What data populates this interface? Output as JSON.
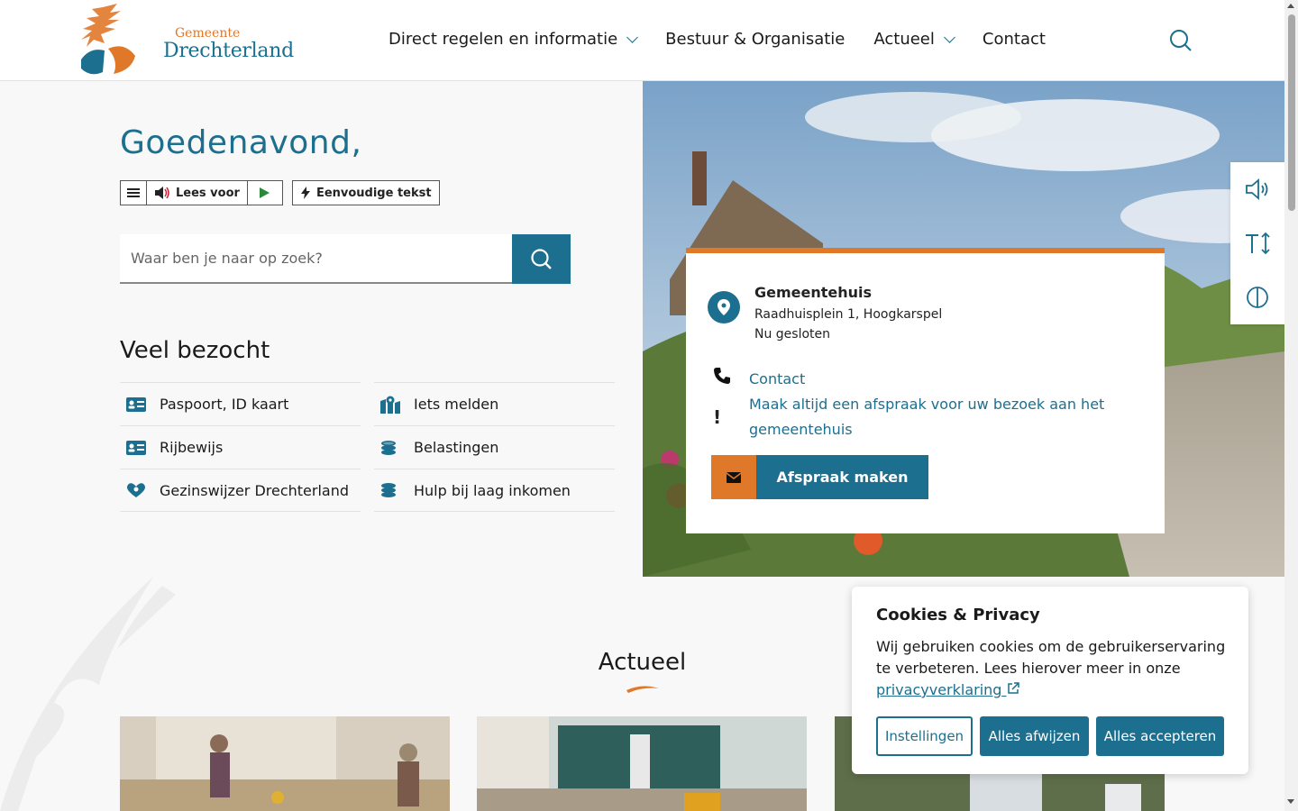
{
  "header": {
    "logo_small": "Gemeente",
    "logo_big": "Drechterland",
    "nav": [
      {
        "label": "Direct regelen en informatie",
        "has_dropdown": true
      },
      {
        "label": "Bestuur & Organisatie",
        "has_dropdown": false
      },
      {
        "label": "Actueel",
        "has_dropdown": true
      },
      {
        "label": "Contact",
        "has_dropdown": false
      }
    ],
    "search_icon": "search-icon"
  },
  "hero": {
    "greeting": "Goedenavond,",
    "readspeaker": {
      "listen_label": "Lees voor",
      "simple_text_label": "Eenvoudige tekst"
    },
    "search": {
      "placeholder": "Waar ben je naar op zoek?"
    },
    "popular_title": "Veel bezocht",
    "popular_links": [
      {
        "label": "Paspoort, ID kaart",
        "icon": "id-card-icon"
      },
      {
        "label": "Iets melden",
        "icon": "map-pin-icon"
      },
      {
        "label": "Rijbewijs",
        "icon": "id-card-icon"
      },
      {
        "label": "Belastingen",
        "icon": "coins-icon"
      },
      {
        "label": "Gezinswijzer Drechterland",
        "icon": "family-heart-icon"
      },
      {
        "label": "Hulp bij laag inkomen",
        "icon": "coins-icon"
      }
    ]
  },
  "info_card": {
    "title": "Gemeentehuis",
    "address": "Raadhuisplein 1, Hoogkarspel",
    "status": "Nu gesloten",
    "contact_link": "Contact",
    "notice": "Maak altijd een afspraak voor uw bezoek aan het gemeentehuis",
    "appointment_button": "Afspraak maken"
  },
  "side_tools": [
    "speaker-icon",
    "text-size-icon",
    "contrast-icon"
  ],
  "actueel": {
    "title": "Actueel"
  },
  "cookie": {
    "title": "Cookies & Privacy",
    "text": "Wij gebruiken cookies om de gebruikerservaring te verbeteren. Lees hierover meer in onze",
    "link": "privacyverklaring",
    "btn_settings": "Instellingen",
    "btn_reject": "Alles afwijzen",
    "btn_accept": "Alles accepteren"
  },
  "colors": {
    "primary": "#1c6f8f",
    "accent": "#e0782a",
    "background": "#f8f8f8"
  }
}
